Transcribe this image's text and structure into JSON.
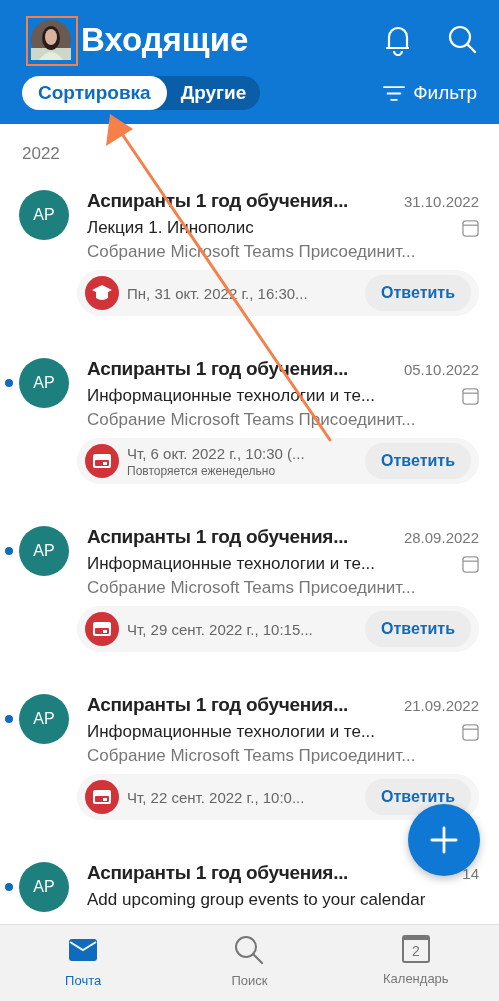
{
  "header": {
    "title": "Входящие",
    "tabs": [
      {
        "label": "Сортировка",
        "selected": true
      },
      {
        "label": "Другие",
        "selected": false
      }
    ],
    "filter": "Фильтр"
  },
  "section": "2022",
  "messages": [
    {
      "initials": "AP",
      "unread": false,
      "sender": "Аспиранты 1 год обучения...",
      "date": "31.10.2022",
      "subject": "Лекция 1. Иннополис",
      "preview": "Собрание Microsoft Teams Присоединит...",
      "event": {
        "kind": "education",
        "time": "Пн, 31 окт. 2022 г., 16:30...",
        "reply": "Ответить"
      }
    },
    {
      "initials": "AP",
      "unread": true,
      "sender": "Аспиранты 1 год обучения...",
      "date": "05.10.2022",
      "subject": "Информационные технологии и те...",
      "preview": "Собрание Microsoft Teams Присоединит...",
      "event": {
        "kind": "meeting",
        "time": "Чт, 6 окт. 2022 г., 10:30 (...",
        "recurrence": "Повторяется еженедельно",
        "reply": "Ответить"
      }
    },
    {
      "initials": "AP",
      "unread": true,
      "sender": "Аспиранты 1 год обучения...",
      "date": "28.09.2022",
      "subject": "Информационные технологии и те...",
      "preview": "Собрание Microsoft Teams Присоединит...",
      "event": {
        "kind": "meeting",
        "time": "Чт, 29 сент. 2022 г., 10:15...",
        "reply": "Ответить"
      }
    },
    {
      "initials": "AP",
      "unread": true,
      "sender": "Аспиранты 1 год обучения...",
      "date": "21.09.2022",
      "subject": "Информационные технологии и те...",
      "preview": "Собрание Microsoft Teams Присоединит...",
      "event": {
        "kind": "meeting",
        "time": "Чт, 22 сент. 2022 г., 10:0...",
        "reply": "Ответить"
      }
    },
    {
      "initials": "AP",
      "unread": true,
      "sender": "Аспиранты 1 год обучения...",
      "date": "14",
      "subject": "Add upcoming group events to your calendar"
    }
  ],
  "nav": [
    {
      "label": "Почта",
      "kind": "mail",
      "selected": true
    },
    {
      "label": "Поиск",
      "kind": "search",
      "selected": false
    },
    {
      "label": "Календарь",
      "kind": "calendar",
      "badge": "2",
      "selected": false
    }
  ]
}
